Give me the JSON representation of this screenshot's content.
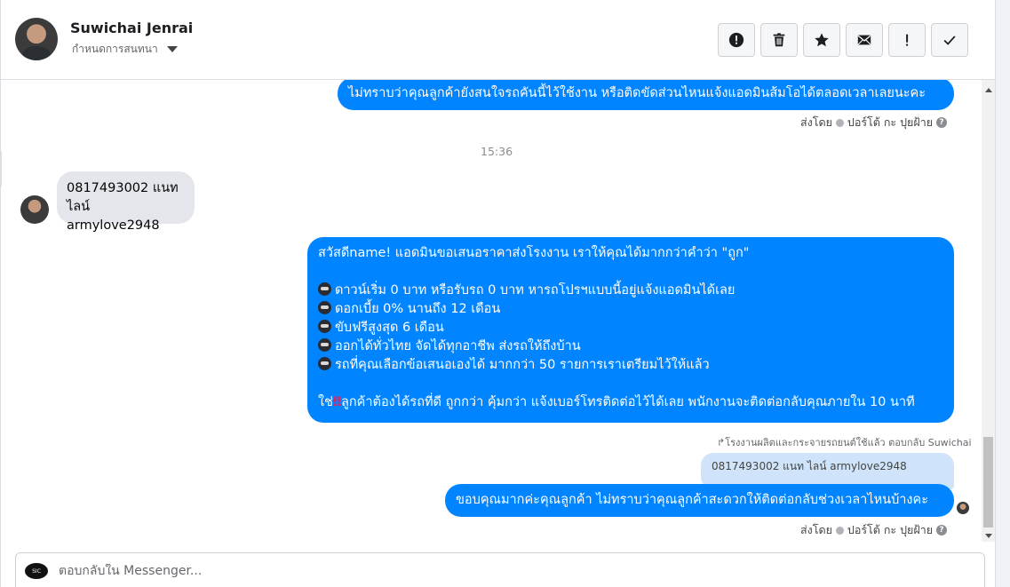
{
  "header": {
    "contact_name": "Suwichai Jenrai",
    "contact_subtitle": "กำหนดการสนทนา",
    "actions": [
      {
        "name": "spam-icon",
        "label": "!"
      },
      {
        "name": "trash-icon",
        "label": "delete"
      },
      {
        "name": "star-icon",
        "label": "star"
      },
      {
        "name": "mail-icon",
        "label": "mail"
      },
      {
        "name": "important-icon",
        "label": "!"
      },
      {
        "name": "done-icon",
        "label": "done"
      }
    ]
  },
  "messages": {
    "msg1": "ไม่ทราบว่าคุณลูกค้ายังสนใจรถคันนี้ไว้ใช้งาน หรือติดขัดส่วนไหนแจ้งแอดมินส้มโอได้ตลอดเวลาเลยนะคะ",
    "meta1": {
      "sent_by": "ส่งโดย",
      "sender": "ปอร์โต้ กะ ปุยฝ้าย"
    },
    "time": "15:36",
    "incoming_line1": "0817493002 แนท",
    "incoming_line2": "ไลน์ armylove2948",
    "promo": {
      "greeting": "สวัสดีname! แอดมินขอเสนอราคาส่งโรงงาน เราให้คุณได้มากกว่าคำว่า \"ถูก\"",
      "bullets": [
        "ดาวน์เริ่ม 0 บาท หรือรับรถ 0 บาท หารถโปรฯแบบนี้อยู่แจ้งแอดมินได้เลย",
        "ดอกเบี้ย 0% นานถึง 12 เดือน",
        "ขับฟรีสูงสุด 6 เดือน",
        "ออกได้ทั่วไทย จัดได้ทุกอาชีพ ส่งรถให้ถึงบ้าน",
        "รถที่คุณเลือกข้อเสนอเองได้ มากกว่า 50 รายการเราเตรียมไว้ให้แล้ว"
      ],
      "closing_pre": "ใช่",
      "closing_emoji": "‼",
      "closing_post": "ลูกค้าต้องได้รถที่ดี ถูกกว่า คุ้มกว่า แจ้งเบอร์โทรติดต่อไว้ได้เลย พนักงานจะติดต่อกลับคุณภายใน 10 นาที"
    },
    "reply_context": "↱โรงงานผลิตและกระจายรถยนต์ใช้แล้ว ตอบกลับ Suwichai",
    "quoted": "0817493002 แนท ไลน์ armylove2948",
    "msg_last": "ขอบคุณมากค่ะคุณลูกค้า ไม่ทราบว่าคุณลูกค้าสะดวกให้ติดต่อกลับช่วงเวลาไหนบ้างคะ",
    "meta2": {
      "sent_by": "ส่งโดย",
      "sender": "ปอร์โต้ กะ ปุยฝ้าย"
    }
  },
  "composer": {
    "placeholder": "ตอบกลับใน Messenger..."
  },
  "colors": {
    "accent": "#0084ff",
    "incoming_bubble": "#e4e6eb"
  }
}
